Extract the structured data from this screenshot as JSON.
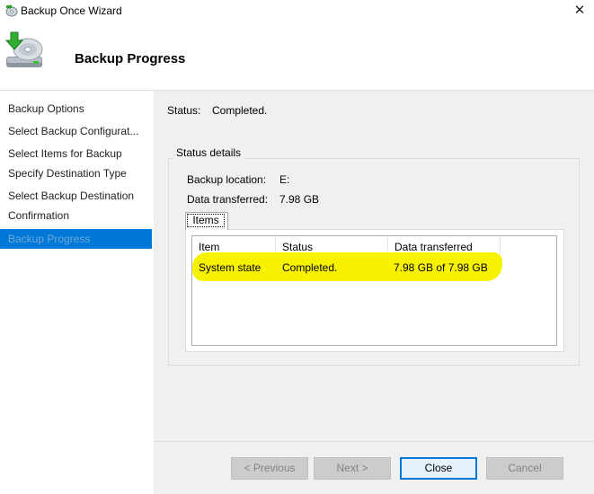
{
  "window": {
    "title": "Backup Once Wizard",
    "close_glyph": "✕"
  },
  "header": {
    "title": "Backup Progress",
    "icon": "backup-disk-icon"
  },
  "nav": {
    "items": [
      {
        "label": "Backup Options"
      },
      {
        "label": "Select Backup Configurat..."
      },
      {
        "label": "Select Items for Backup"
      },
      {
        "label": "Specify Destination Type"
      },
      {
        "label": "Select Backup Destination"
      },
      {
        "label": "Confirmation"
      },
      {
        "label": "Backup Progress",
        "selected": true
      }
    ]
  },
  "status": {
    "label": "Status:",
    "value": "Completed."
  },
  "details": {
    "group_title": "Status details",
    "location_label": "Backup location:",
    "location_value": "E:",
    "transferred_label": "Data transferred:",
    "transferred_value": "7.98 GB"
  },
  "tabs": {
    "items_label": "Items"
  },
  "table": {
    "columns": [
      "Item",
      "Status",
      "Data transferred"
    ],
    "rows": [
      [
        "System state",
        "Completed.",
        "7.98 GB of 7.98 GB"
      ]
    ]
  },
  "buttons": {
    "previous": "< Previous",
    "next": "Next >",
    "close": "Close",
    "cancel": "Cancel"
  },
  "colors": {
    "selection": "#0078d7",
    "highlight": "#f7f300",
    "content_bg": "#f0f0f0"
  }
}
